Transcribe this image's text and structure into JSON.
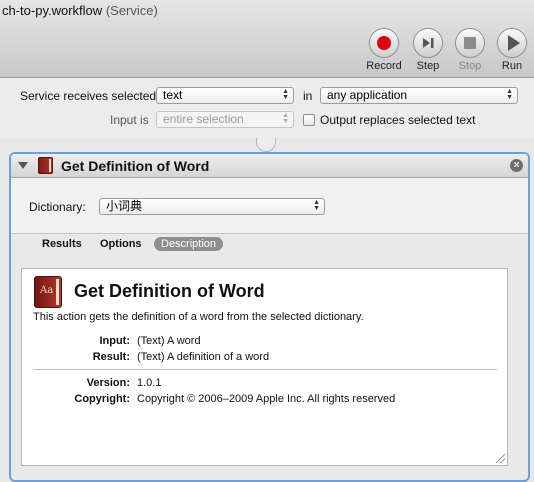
{
  "window": {
    "title": "ch-to-py.workflow",
    "subtitle": "(Service)"
  },
  "toolbar": {
    "buttons": [
      {
        "label": "Record",
        "icon": "record-icon",
        "enabled": true
      },
      {
        "label": "Step",
        "icon": "step-icon",
        "enabled": true
      },
      {
        "label": "Stop",
        "icon": "stop-icon",
        "enabled": false
      },
      {
        "label": "Run",
        "icon": "run-icon",
        "enabled": true
      }
    ]
  },
  "service": {
    "receives_label": "Service receives selected",
    "receives_value": "text",
    "in_label": "in",
    "in_value": "any application",
    "input_is_label": "Input is",
    "input_is_value": "entire selection",
    "output_replaces_label": "Output replaces selected text",
    "output_replaces_checked": false
  },
  "action": {
    "title": "Get Definition of Word",
    "dictionary_label": "Dictionary:",
    "dictionary_value": "小词典",
    "tabs": [
      "Results",
      "Options",
      "Description"
    ],
    "selected_tab": "Description",
    "description": {
      "icon_text": "Aa",
      "title": "Get Definition of Word",
      "summary": "This action gets the definition of a word from the selected dictionary.",
      "input_label": "Input:",
      "input_value": "(Text) A word",
      "result_label": "Result:",
      "result_value": "(Text) A definition of a word",
      "version_label": "Version:",
      "version_value": "1.0.1",
      "copyright_label": "Copyright:",
      "copyright_value": "Copyright © 2006–2009 Apple Inc.  All rights reserved"
    }
  },
  "colors": {
    "record": "#e00010",
    "selection_border": "#6f9fd8",
    "book": "#a02a25"
  }
}
